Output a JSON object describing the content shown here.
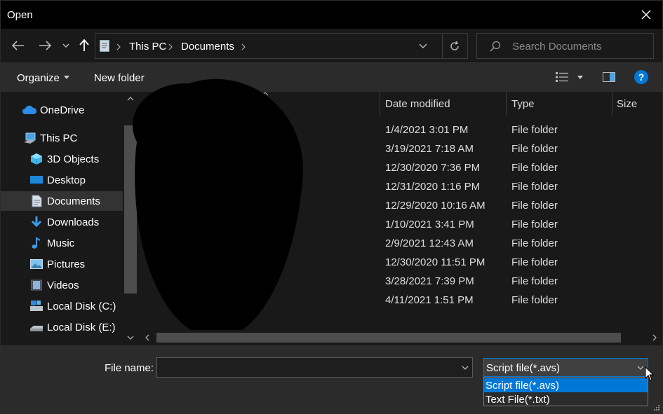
{
  "window": {
    "title": "Open"
  },
  "nav": {
    "breadcrumb": [
      "This PC",
      "Documents"
    ],
    "search_placeholder": "Search Documents"
  },
  "toolbar": {
    "organize": "Organize",
    "new_folder": "New folder"
  },
  "sidebar": {
    "items": [
      {
        "label": "OneDrive",
        "icon": "cloud-icon"
      },
      {
        "label": "This PC",
        "icon": "computer-icon"
      },
      {
        "label": "3D Objects",
        "icon": "cube-icon"
      },
      {
        "label": "Desktop",
        "icon": "desktop-icon"
      },
      {
        "label": "Documents",
        "icon": "document-icon"
      },
      {
        "label": "Downloads",
        "icon": "download-icon"
      },
      {
        "label": "Music",
        "icon": "music-icon"
      },
      {
        "label": "Pictures",
        "icon": "pictures-icon"
      },
      {
        "label": "Videos",
        "icon": "video-icon"
      },
      {
        "label": "Local Disk (C:)",
        "icon": "drive-icon"
      },
      {
        "label": "Local Disk (E:)",
        "icon": "drive-icon"
      }
    ]
  },
  "files": {
    "columns": [
      "Date modified",
      "Type",
      "Size"
    ],
    "rows": [
      {
        "date": "1/4/2021 3:01 PM",
        "type": "File folder"
      },
      {
        "date": "3/19/2021 7:18 AM",
        "type": "File folder"
      },
      {
        "date": "12/30/2020 7:36 PM",
        "type": "File folder"
      },
      {
        "date": "12/31/2020 1:16 PM",
        "type": "File folder"
      },
      {
        "date": "12/29/2020 10:16 AM",
        "type": "File folder"
      },
      {
        "date": "1/10/2021 3:41 PM",
        "type": "File folder"
      },
      {
        "date": "2/9/2021 12:43 AM",
        "type": "File folder"
      },
      {
        "date": "12/30/2020 11:51 PM",
        "type": "File folder"
      },
      {
        "date": "3/28/2021 7:39 PM",
        "type": "File folder"
      },
      {
        "date": "4/11/2021 1:51 PM",
        "type": "File folder"
      }
    ]
  },
  "footer": {
    "file_name_label": "File name:",
    "file_name_value": "",
    "file_type_selected": "Script file(*.avs)",
    "file_type_options": [
      "Script file(*.avs)",
      "Text File(*.txt)"
    ]
  },
  "colors": {
    "accent": "#0078d7",
    "background": "#191919",
    "panel": "#2b2b2b"
  }
}
